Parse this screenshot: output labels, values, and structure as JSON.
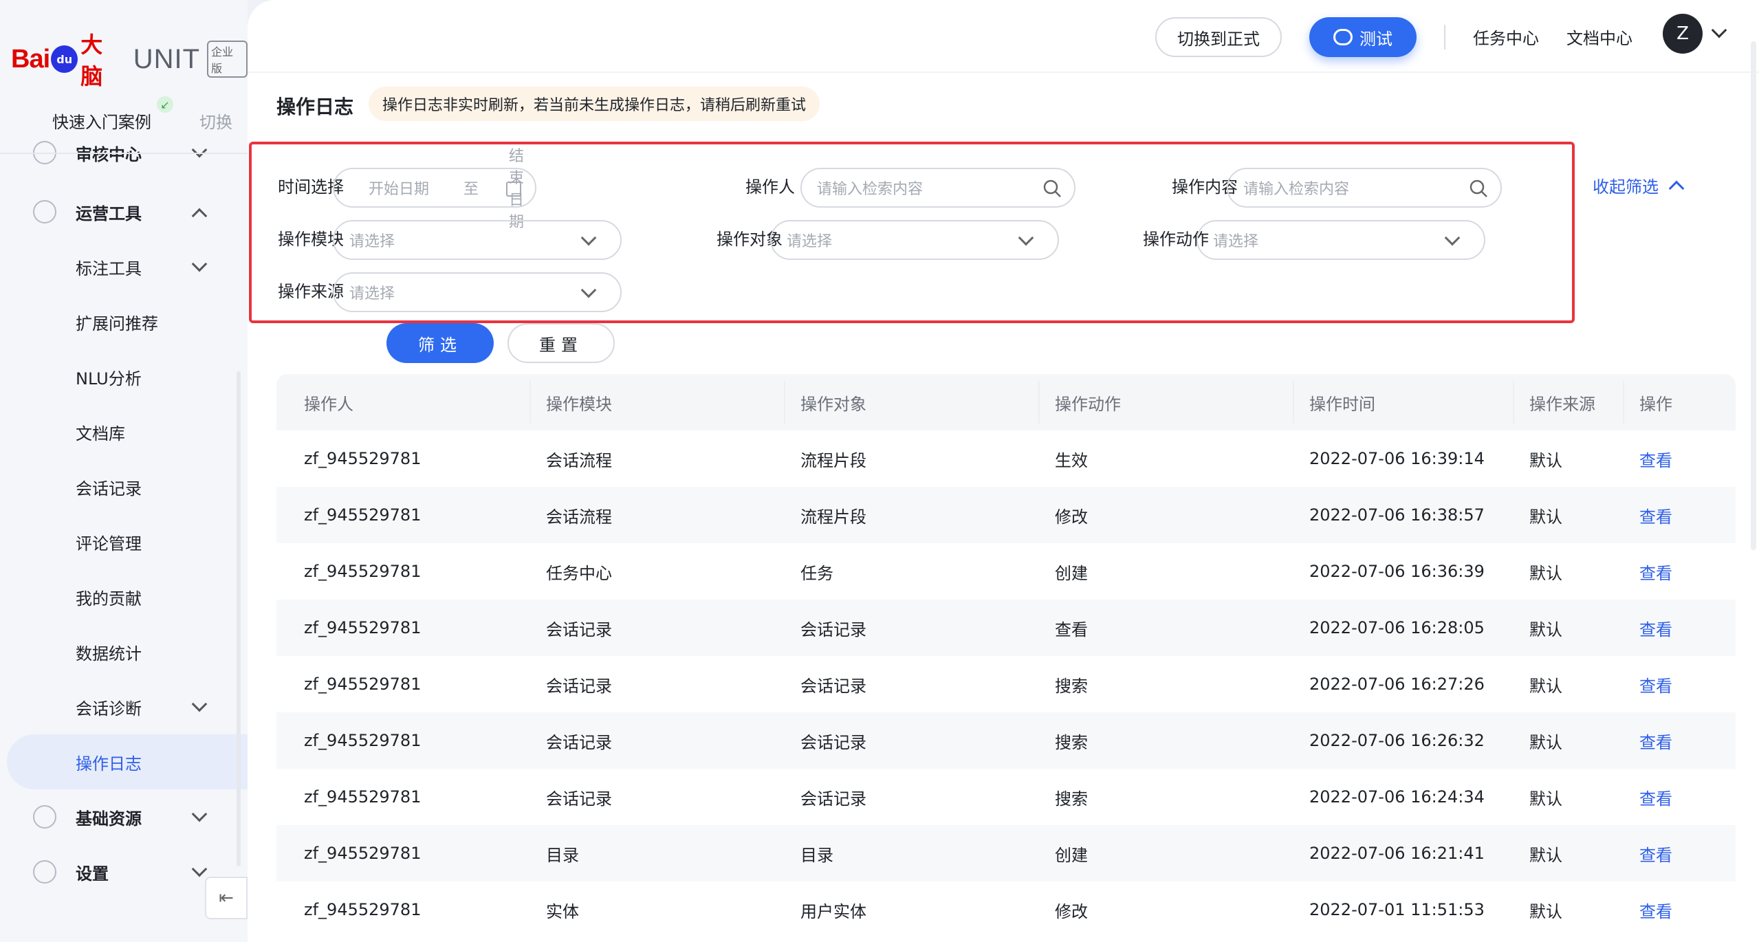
{
  "brand": {
    "bai": "Bai",
    "du": "du",
    "danao": "大脑",
    "unit": "UNIT",
    "edition": "企业版"
  },
  "sidebar": {
    "quick_start": "快速入门案例",
    "switch": "切换",
    "items": [
      {
        "label": "审核中心",
        "icon": "audit-icon",
        "chevron": "down"
      },
      {
        "label": "运营工具",
        "icon": "tools-icon",
        "chevron": "up",
        "group": true
      },
      {
        "label": "标注工具",
        "chevron": "down"
      },
      {
        "label": "扩展问推荐"
      },
      {
        "label": "NLU分析"
      },
      {
        "label": "文档库"
      },
      {
        "label": "会话记录"
      },
      {
        "label": "评论管理"
      },
      {
        "label": "我的贡献"
      },
      {
        "label": "数据统计"
      },
      {
        "label": "会话诊断",
        "chevron": "down"
      },
      {
        "label": "操作日志",
        "active": true
      },
      {
        "label": "基础资源",
        "icon": "resources-icon",
        "chevron": "down",
        "group": true
      },
      {
        "label": "设置",
        "icon": "settings-icon",
        "chevron": "down",
        "group": true
      }
    ]
  },
  "topbar": {
    "switch_env": "切换到正式",
    "test": "测试",
    "task_center": "任务中心",
    "doc_center": "文档中心",
    "avatar_initial": "Z"
  },
  "page": {
    "title": "操作日志",
    "notice": "操作日志非实时刷新，若当前未生成操作日志，请稍后刷新重试"
  },
  "filters": {
    "time_label": "时间选择",
    "start_placeholder": "开始日期",
    "to": "至",
    "end_placeholder": "结束日期",
    "operator_label": "操作人",
    "operator_placeholder": "请输入检索内容",
    "content_label": "操作内容",
    "content_placeholder": "请输入检索内容",
    "collapse": "收起筛选",
    "module_label": "操作模块",
    "module_placeholder": "请选择",
    "object_label": "操作对象",
    "object_placeholder": "请选择",
    "action_label": "操作动作",
    "action_placeholder": "请选择",
    "source_label": "操作来源",
    "source_placeholder": "请选择",
    "filter_btn": "筛选",
    "reset_btn": "重置"
  },
  "table": {
    "headers": [
      "操作人",
      "操作模块",
      "操作对象",
      "操作动作",
      "操作时间",
      "操作来源",
      "操作"
    ],
    "rows": [
      [
        "zf_945529781",
        "会话流程",
        "流程片段",
        "生效",
        "2022-07-06 16:39:14",
        "默认",
        "查看"
      ],
      [
        "zf_945529781",
        "会话流程",
        "流程片段",
        "修改",
        "2022-07-06 16:38:57",
        "默认",
        "查看"
      ],
      [
        "zf_945529781",
        "任务中心",
        "任务",
        "创建",
        "2022-07-06 16:36:39",
        "默认",
        "查看"
      ],
      [
        "zf_945529781",
        "会话记录",
        "会话记录",
        "查看",
        "2022-07-06 16:28:05",
        "默认",
        "查看"
      ],
      [
        "zf_945529781",
        "会话记录",
        "会话记录",
        "搜索",
        "2022-07-06 16:27:26",
        "默认",
        "查看"
      ],
      [
        "zf_945529781",
        "会话记录",
        "会话记录",
        "搜索",
        "2022-07-06 16:26:32",
        "默认",
        "查看"
      ],
      [
        "zf_945529781",
        "会话记录",
        "会话记录",
        "搜索",
        "2022-07-06 16:24:34",
        "默认",
        "查看"
      ],
      [
        "zf_945529781",
        "目录",
        "目录",
        "创建",
        "2022-07-06 16:21:41",
        "默认",
        "查看"
      ],
      [
        "zf_945529781",
        "实体",
        "用户实体",
        "修改",
        "2022-07-01 11:51:53",
        "默认",
        "查看"
      ]
    ]
  },
  "colors": {
    "accent": "#2e6bf0",
    "highlight_border": "#e8343f",
    "brand_red": "#e10601"
  }
}
